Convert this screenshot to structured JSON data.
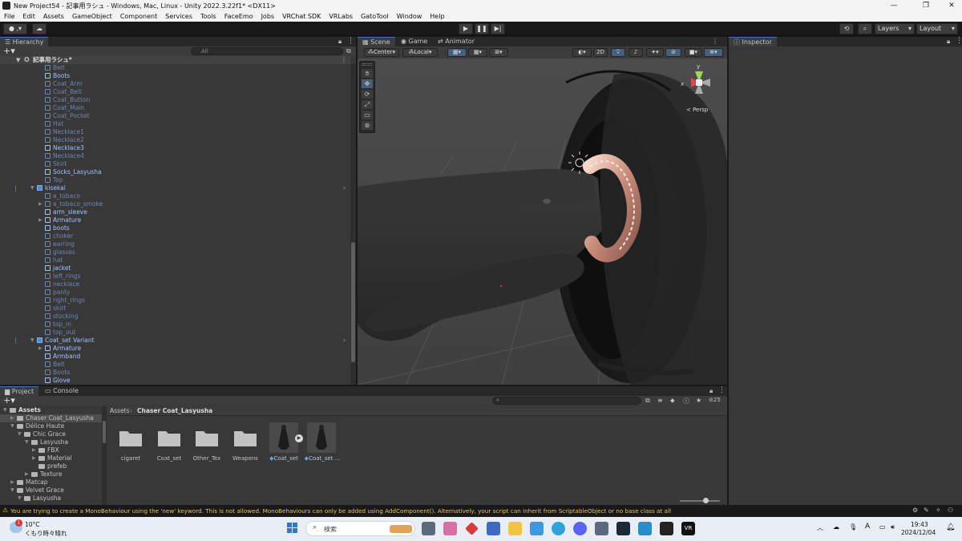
{
  "window": {
    "title": "New Project54 - 記事用ラシュ - Windows, Mac, Linux - Unity 2022.3.22f1* <DX11>"
  },
  "menu": [
    "File",
    "Edit",
    "Assets",
    "GameObject",
    "Component",
    "Services",
    "Tools",
    "FaceEmo",
    "Jobs",
    "VRChat SDK",
    "VRLabs",
    "GatoTool",
    "Window",
    "Help"
  ],
  "toolbar": {
    "layers_label": "Layers",
    "layout_label": "Layout"
  },
  "hierarchy": {
    "tab_label": "Hierarchy",
    "search_placeholder": "All",
    "scene_name": "記事用ラシュ*",
    "rows": [
      {
        "label": "Belt",
        "active": false,
        "indent": 3,
        "expander": false
      },
      {
        "label": "Boots",
        "active": true,
        "indent": 3,
        "expander": false
      },
      {
        "label": "Coat_Arm",
        "active": false,
        "indent": 3,
        "expander": false
      },
      {
        "label": "Coat_Belt",
        "active": false,
        "indent": 3,
        "expander": false
      },
      {
        "label": "Coat_Button",
        "active": false,
        "indent": 3,
        "expander": false
      },
      {
        "label": "Coat_Main",
        "active": false,
        "indent": 3,
        "expander": false
      },
      {
        "label": "Coat_Pocket",
        "active": false,
        "indent": 3,
        "expander": false
      },
      {
        "label": "Hat",
        "active": false,
        "indent": 3,
        "expander": false
      },
      {
        "label": "Necklace1",
        "active": false,
        "indent": 3,
        "expander": false
      },
      {
        "label": "Necklace2",
        "active": false,
        "indent": 3,
        "expander": false
      },
      {
        "label": "Necklace3",
        "active": true,
        "indent": 3,
        "expander": false
      },
      {
        "label": "Necklace4",
        "active": false,
        "indent": 3,
        "expander": false
      },
      {
        "label": "Skirt",
        "active": false,
        "indent": 3,
        "expander": false
      },
      {
        "label": "Socks_Lasyusha",
        "active": true,
        "indent": 3,
        "expander": false
      },
      {
        "label": "Top",
        "active": false,
        "indent": 3,
        "expander": false
      },
      {
        "label": "kisekai",
        "active": true,
        "indent": 2,
        "expander": true,
        "prefab": true
      },
      {
        "label": "a_tobaco",
        "active": false,
        "indent": 3,
        "expander": false
      },
      {
        "label": "a_tobaco_smoke",
        "active": false,
        "indent": 3,
        "expander": true
      },
      {
        "label": "arm_sleeve",
        "active": true,
        "indent": 3,
        "expander": false
      },
      {
        "label": "Armature",
        "active": true,
        "indent": 3,
        "expander": true
      },
      {
        "label": "boots",
        "active": true,
        "indent": 3,
        "expander": false
      },
      {
        "label": "choker",
        "active": false,
        "indent": 3,
        "expander": false
      },
      {
        "label": "earring",
        "active": false,
        "indent": 3,
        "expander": false
      },
      {
        "label": "glasses",
        "active": false,
        "indent": 3,
        "expander": false
      },
      {
        "label": "hat",
        "active": false,
        "indent": 3,
        "expander": false
      },
      {
        "label": "jacket",
        "active": true,
        "indent": 3,
        "expander": false
      },
      {
        "label": "left_rings",
        "active": false,
        "indent": 3,
        "expander": false
      },
      {
        "label": "necklace",
        "active": false,
        "indent": 3,
        "expander": false
      },
      {
        "label": "panty",
        "active": false,
        "indent": 3,
        "expander": false
      },
      {
        "label": "right_rings",
        "active": false,
        "indent": 3,
        "expander": false
      },
      {
        "label": "skirt",
        "active": false,
        "indent": 3,
        "expander": false
      },
      {
        "label": "stocking",
        "active": false,
        "indent": 3,
        "expander": false
      },
      {
        "label": "top_in",
        "active": false,
        "indent": 3,
        "expander": false
      },
      {
        "label": "top_out",
        "active": false,
        "indent": 3,
        "expander": false
      },
      {
        "label": "Coat_set Variant",
        "active": true,
        "indent": 2,
        "expander": true,
        "prefab": true
      },
      {
        "label": "Armature",
        "active": true,
        "indent": 3,
        "expander": true
      },
      {
        "label": "Armband",
        "active": true,
        "indent": 3,
        "expander": false
      },
      {
        "label": "Belt",
        "active": false,
        "indent": 3,
        "expander": false
      },
      {
        "label": "Boots",
        "active": false,
        "indent": 3,
        "expander": false
      },
      {
        "label": "Glove",
        "active": true,
        "indent": 3,
        "expander": false
      }
    ]
  },
  "scene": {
    "tabs": [
      "Scene",
      "Game",
      "Animator"
    ],
    "pivot_label": "Center",
    "space_label": "Local",
    "mode_2d_label": "2D",
    "persp_label": "< Persp"
  },
  "inspector": {
    "tab_label": "Inspector"
  },
  "project": {
    "tabs": [
      "Project",
      "Console"
    ],
    "badge_count": "25",
    "breadcrumb": [
      "Assets",
      "Chaser Coat_Lasyusha"
    ],
    "tree": [
      {
        "label": "Assets",
        "depth": 0,
        "bold": true
      },
      {
        "label": "Chaser Coat_Lasyusha",
        "depth": 1,
        "selected": true
      },
      {
        "label": "Délice Haute",
        "depth": 1
      },
      {
        "label": "Chic Grace",
        "depth": 2
      },
      {
        "label": "Lasyusha",
        "depth": 3
      },
      {
        "label": "FBX",
        "depth": 4
      },
      {
        "label": "Material",
        "depth": 4
      },
      {
        "label": "prefeb",
        "depth": 4
      },
      {
        "label": "Texture",
        "depth": 3
      },
      {
        "label": "Matcap",
        "depth": 1
      },
      {
        "label": "Velvet Grace",
        "depth": 1
      },
      {
        "label": "Lasyusha",
        "depth": 2
      }
    ],
    "assets": [
      {
        "label": "cigaret",
        "kind": "folder"
      },
      {
        "label": "Coat_set",
        "kind": "folder"
      },
      {
        "label": "Other_Tex",
        "kind": "folder"
      },
      {
        "label": "Weapons",
        "kind": "folder"
      },
      {
        "label": "Coat_set",
        "kind": "prefab"
      },
      {
        "label": "Coat_set ...",
        "kind": "prefab"
      }
    ]
  },
  "status": {
    "message": "You are trying to create a MonoBehaviour using the 'new' keyword.  This is not allowed.  MonoBehaviours can only be added using AddComponent(). Alternatively, your script can inherit from ScriptableObject or no base class at all"
  },
  "taskbar": {
    "weather_temp": "10°C",
    "weather_desc": "くもり時々晴れ",
    "weather_badge": "1",
    "search_placeholder": "検索",
    "time": "19:43",
    "date": "2024/12/04",
    "ime": "A"
  },
  "colors": {
    "accent": "#3a79bb",
    "warning": "#f0c000",
    "panel": "#383838"
  }
}
